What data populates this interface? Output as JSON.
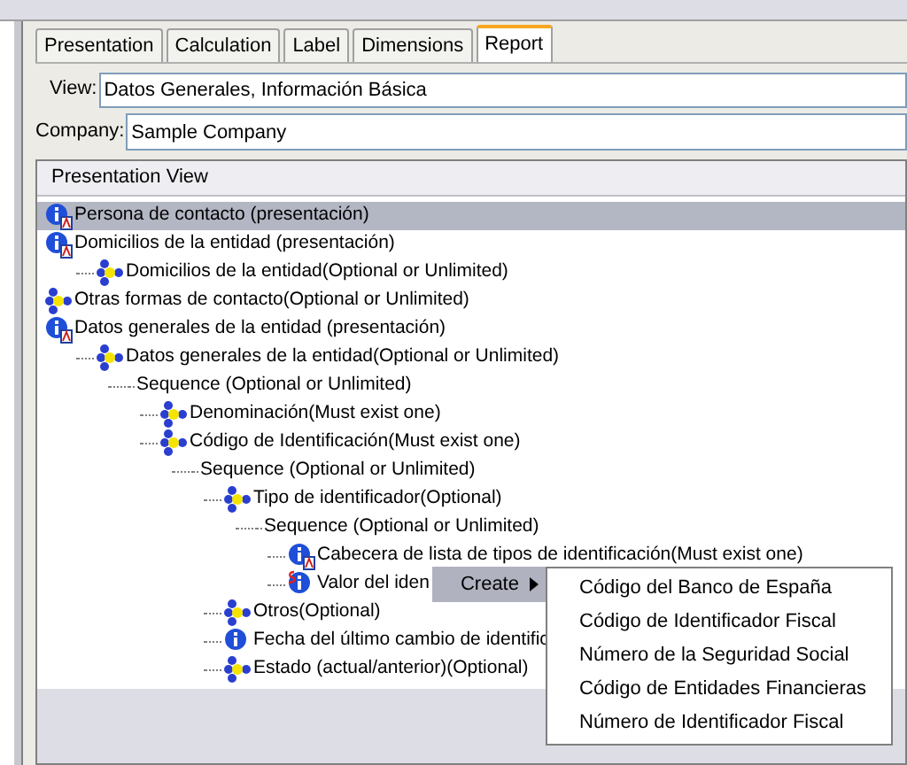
{
  "tabs": [
    {
      "label": "Presentation",
      "selected": false
    },
    {
      "label": "Calculation",
      "selected": false
    },
    {
      "label": "Label",
      "selected": false
    },
    {
      "label": "Dimensions",
      "selected": false
    },
    {
      "label": "Report",
      "selected": true
    }
  ],
  "view": {
    "label": "View:",
    "value": "Datos Generales, Información Básica"
  },
  "company": {
    "label": "Company:",
    "value": "Sample Company"
  },
  "tree": {
    "header": "Presentation View",
    "items": [
      {
        "kind": "info_attr",
        "label": "Persona de contacto (presentación)",
        "selected": true
      },
      {
        "kind": "info_attr",
        "label": "Domicilios de la entidad (presentación)",
        "selected": false,
        "children": [
          {
            "kind": "tuple",
            "label": "Domicilios de la entidad(Optional or Unlimited)",
            "selected": false
          }
        ]
      },
      {
        "kind": "tuple",
        "label": "Otras formas de contacto(Optional or Unlimited)",
        "selected": false
      },
      {
        "kind": "info_attr",
        "label": "Datos generales de la entidad (presentación)",
        "selected": false,
        "children": [
          {
            "kind": "tuple",
            "label": "Datos generales de la entidad(Optional or Unlimited)",
            "selected": false,
            "children": [
              {
                "kind": "sequence",
                "label": "Sequence (Optional or Unlimited)",
                "selected": false,
                "children": [
                  {
                    "kind": "tuple",
                    "label": "Denominación(Must exist one)",
                    "selected": false
                  },
                  {
                    "kind": "tuple",
                    "label": "Código de Identificación(Must exist one)",
                    "selected": false,
                    "children": [
                      {
                        "kind": "sequence",
                        "label": "Sequence (Optional or Unlimited)",
                        "selected": false,
                        "children": [
                          {
                            "kind": "tuple",
                            "label": "Tipo de identificador(Optional)",
                            "selected": false,
                            "children": [
                              {
                                "kind": "sequence",
                                "label": "Sequence (Optional or Unlimited)",
                                "selected": false,
                                "children": [
                                  {
                                    "kind": "info_attr",
                                    "label": "Cabecera de lista de tipos de identificación(Must exist one)",
                                    "selected": false
                                  },
                                  {
                                    "kind": "info_s",
                                    "label": "Valor del iden",
                                    "selected": false
                                  }
                                ]
                              }
                            ]
                          },
                          {
                            "kind": "tuple",
                            "label": "Otros(Optional)",
                            "selected": false
                          },
                          {
                            "kind": "info",
                            "label": "Fecha del último cambio de identific",
                            "selected": false
                          },
                          {
                            "kind": "tuple",
                            "label": "Estado (actual/anterior)(Optional)",
                            "selected": false
                          }
                        ]
                      }
                    ]
                  }
                ]
              }
            ]
          }
        ]
      }
    ]
  },
  "context_menu": {
    "label": "Create",
    "submenu": [
      "Código del Banco de España",
      "Código de Identificador Fiscal",
      "Número de la Seguridad Social",
      "Código de Entidades Financieras",
      "Número de Identificador Fiscal"
    ]
  }
}
